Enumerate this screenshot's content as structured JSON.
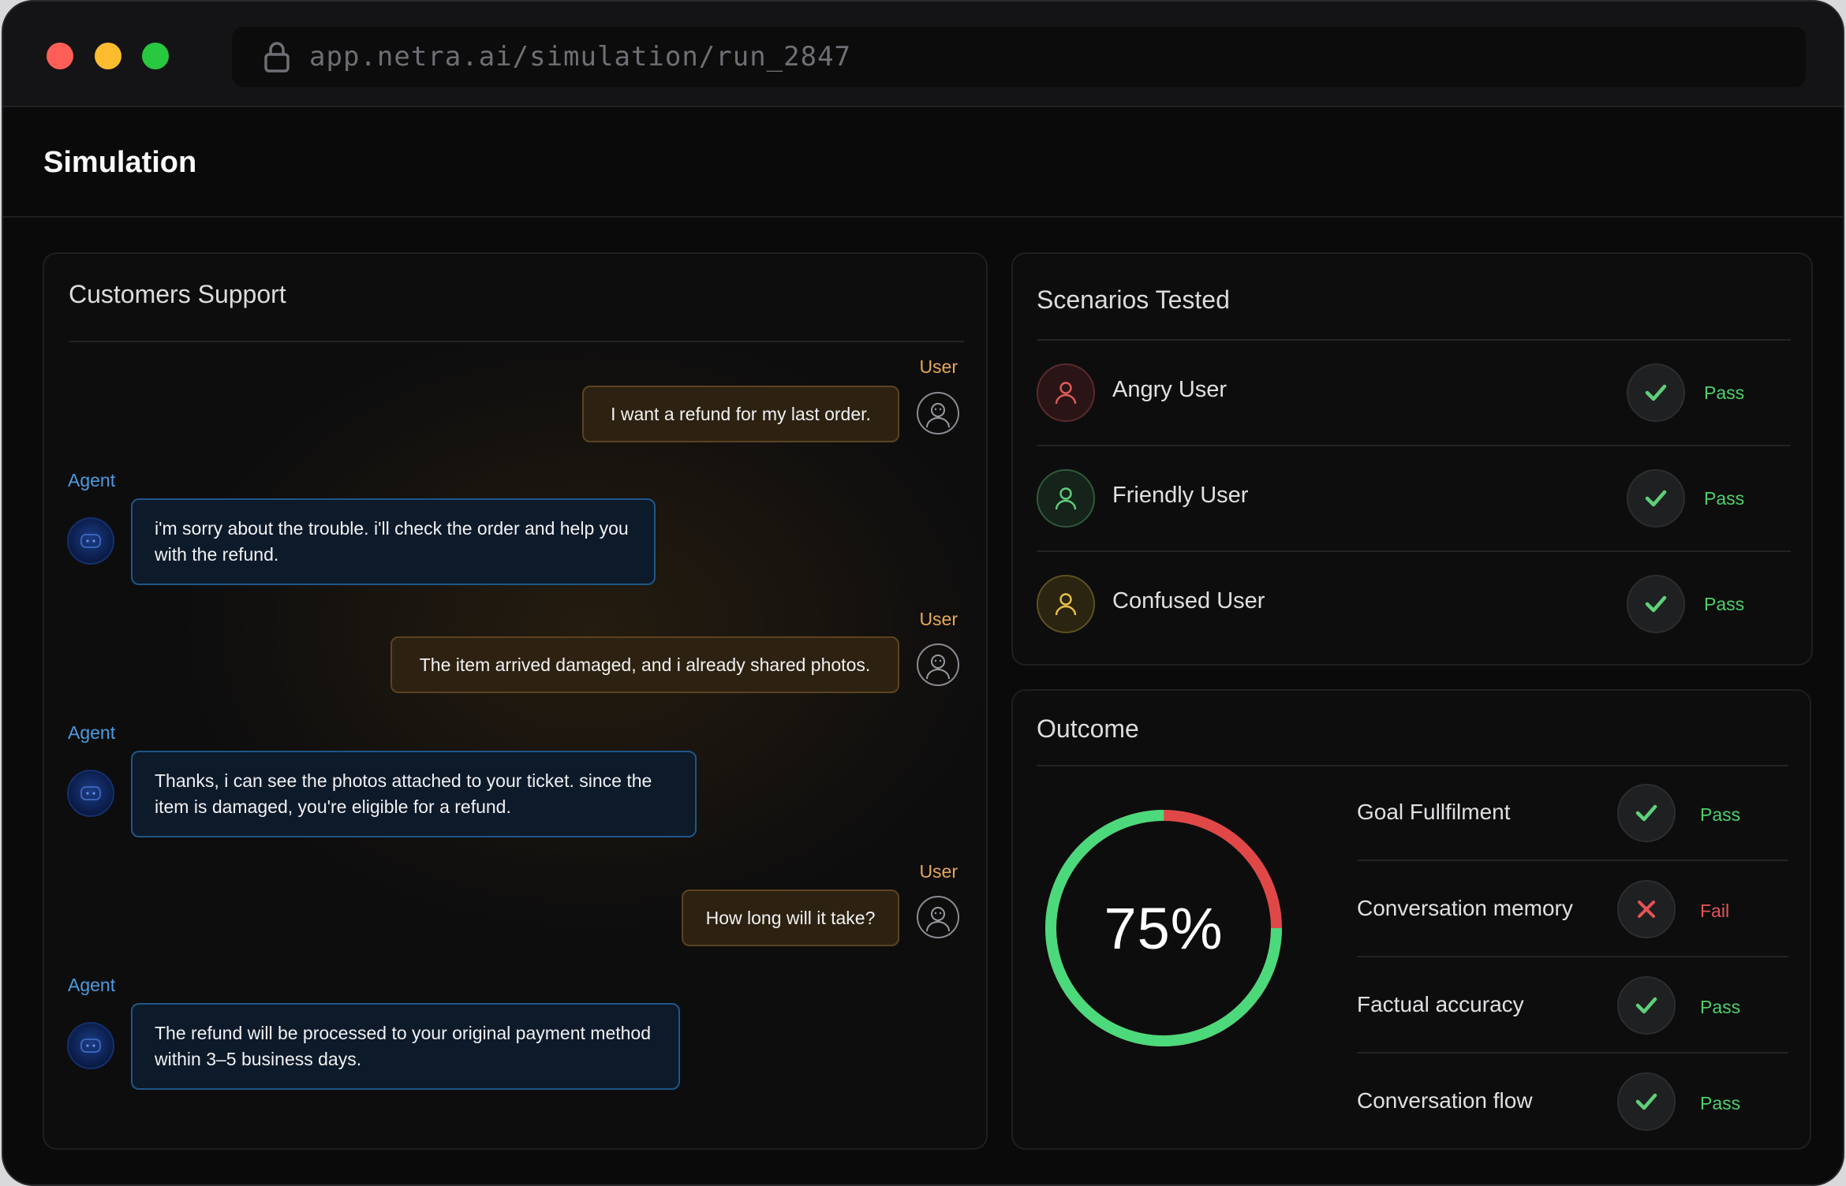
{
  "browser": {
    "url": "app.netra.ai/simulation/run_2847"
  },
  "header": {
    "title": "Simulation"
  },
  "chat": {
    "title": "Customers Support",
    "user_role": "User",
    "agent_role": "Agent",
    "messages": [
      {
        "role": "user",
        "text": "I want a refund for my last order."
      },
      {
        "role": "agent",
        "text": "i'm sorry about the trouble. i'll check the order and help you with the refund."
      },
      {
        "role": "user",
        "text": "The item arrived damaged, and i already shared photos."
      },
      {
        "role": "agent",
        "text": "Thanks, i can see the photos attached to your ticket. since the item is damaged, you're eligible for a refund."
      },
      {
        "role": "user",
        "text": "How long will it take?"
      },
      {
        "role": "agent",
        "text": "The refund will be processed to your original payment method within 3–5 business days."
      }
    ]
  },
  "scenarios": {
    "title": "Scenarios Tested",
    "items": [
      {
        "label": "Angry User",
        "status": "Pass",
        "color": "#e05a5a"
      },
      {
        "label": "Friendly User",
        "status": "Pass",
        "color": "#5fd07a"
      },
      {
        "label": "Confused User",
        "status": "Pass",
        "color": "#e8c04a"
      }
    ]
  },
  "outcome": {
    "title": "Outcome",
    "score_label": "75%",
    "score": 0.75,
    "colors": {
      "pass": "#4cd97b",
      "fail": "#e04848"
    },
    "items": [
      {
        "label": "Goal Fullfilment",
        "status": "Pass",
        "result": "pass"
      },
      {
        "label": "Conversation memory",
        "status": "Fail",
        "result": "fail"
      },
      {
        "label": "Factual accuracy",
        "status": "Pass",
        "result": "pass"
      },
      {
        "label": "Conversation flow",
        "status": "Pass",
        "result": "pass"
      }
    ]
  }
}
